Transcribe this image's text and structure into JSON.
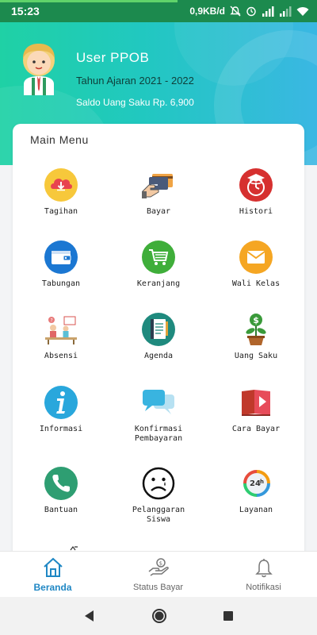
{
  "status_bar": {
    "time": "15:23",
    "speed": "0,9KB/d"
  },
  "header": {
    "user_name": "User PPOB",
    "school_year": "Tahun Ajaran 2021 - 2022",
    "balance": "Saldo Uang Saku Rp. 6,900"
  },
  "main_menu": {
    "title": "Main Menu",
    "items": [
      {
        "label": "Tagihan",
        "icon": "cloud-download-icon"
      },
      {
        "label": "Bayar",
        "icon": "hand-card-icon"
      },
      {
        "label": "Histori",
        "icon": "graduation-clock-icon"
      },
      {
        "label": "Tabungan",
        "icon": "wallet-icon"
      },
      {
        "label": "Keranjang",
        "icon": "cart-icon"
      },
      {
        "label": "Wali Kelas",
        "icon": "envelope-icon"
      },
      {
        "label": "Absensi",
        "icon": "classroom-icon"
      },
      {
        "label": "Agenda",
        "icon": "notebook-icon"
      },
      {
        "label": "Uang Saku",
        "icon": "money-plant-icon"
      },
      {
        "label": "Informasi",
        "icon": "info-icon"
      },
      {
        "label": "Konfirmasi\nPembayaran",
        "icon": "chat-bubbles-icon"
      },
      {
        "label": "Cara Bayar",
        "icon": "video-book-icon"
      },
      {
        "label": "Bantuan",
        "icon": "phone-icon"
      },
      {
        "label": "Pelanggaran\nSiswa",
        "icon": "sad-face-icon"
      },
      {
        "label": "Layanan",
        "icon": "24h-service-icon"
      }
    ]
  },
  "bottom_nav": {
    "items": [
      {
        "label": "Beranda",
        "icon": "home-icon",
        "active": true
      },
      {
        "label": "Status Bayar",
        "icon": "hand-coin-icon",
        "active": false
      },
      {
        "label": "Notifikasi",
        "icon": "bell-icon",
        "active": false
      }
    ]
  },
  "colors": {
    "status_bar": "#1c8a4e",
    "header_start": "#1fd1a5",
    "header_end": "#3ab7e3",
    "active_nav": "#1f87c4"
  }
}
